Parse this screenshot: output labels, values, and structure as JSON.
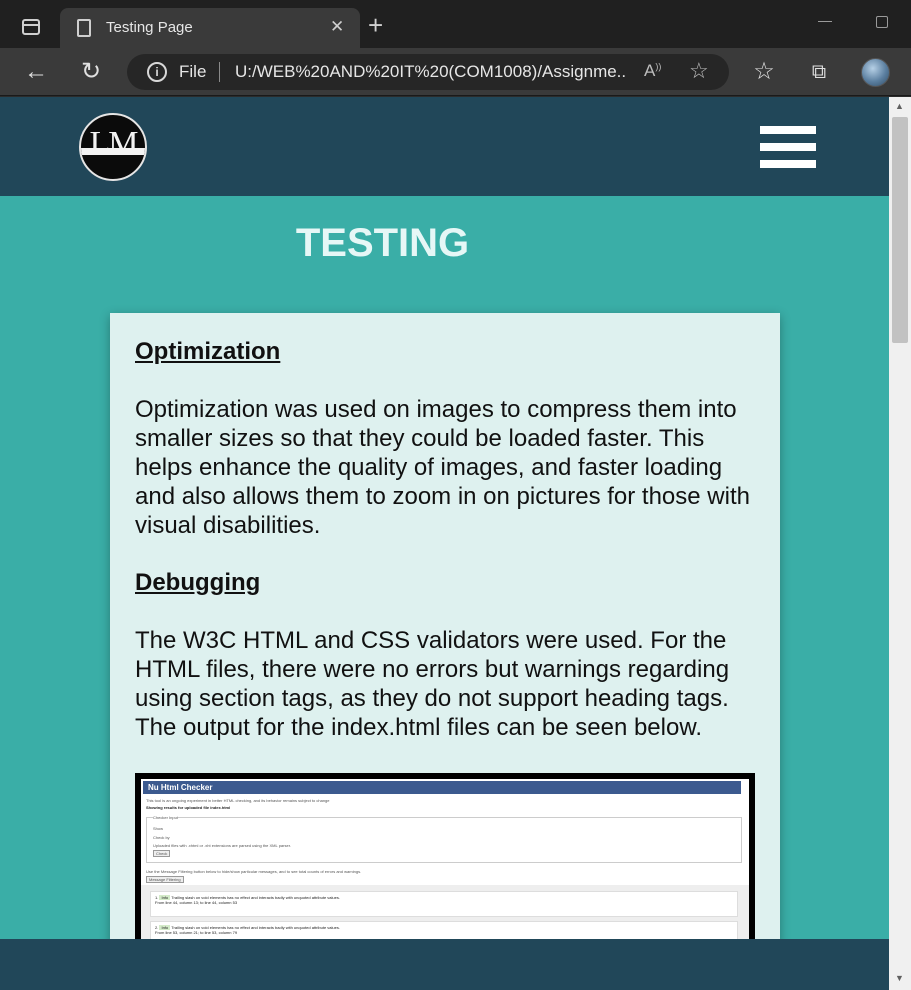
{
  "browser": {
    "tab_title": "Testing Page",
    "tab_close": "✕",
    "new_tab": "+",
    "file_label": "File",
    "url": "U:/WEB%20AND%20IT%20(COM1008)/Assignme...",
    "read_aloud": "A",
    "back": "←",
    "refresh": "↻",
    "favorites": "☆",
    "info": "i"
  },
  "site": {
    "logo_text": "LM",
    "page_title": "TESTING"
  },
  "content": {
    "optimization_heading": "Optimization",
    "optimization_text": "Optimization was used on images to compress them into smaller sizes so that they could be loaded faster. This helps enhance the quality of images, and faster loading and also allows them to zoom in on pictures for those with visual disabilities.",
    "debugging_heading": "Debugging",
    "debugging_text": "The W3C HTML and CSS validators were used. For the HTML files, there were no errors but warnings regarding using section tags, as they do not support heading tags. The output for the index.html files can be seen below."
  },
  "validator": {
    "title": "Nu Html Checker",
    "intro": "This tool is an ongoing experiment in better HTML checking, and its behavior remains subject to change",
    "results_for": "Showing results for uploaded file index.html",
    "checker_input": "Checker Input",
    "show_label": "Show",
    "check_by": "Check by",
    "upload_note": "Uploaded files with .xhtml or .xht extensions are parsed using the XML parser.",
    "check_button": "Check",
    "filter_note": "Use the Message Filtering button below to hide/show particular messages, and to see total counts of errors and warnings.",
    "filter_button": "Message Filtering",
    "messages": [
      {
        "num": "1.",
        "tag": "Info",
        "text": "Trailing slash on void elements has no effect and interacts badly with unquoted attribute values.",
        "loc": "From line 44, column 13; to line 44, column 53"
      },
      {
        "num": "2.",
        "tag": "Info",
        "text": "Trailing slash on void elements has no effect and interacts badly with unquoted attribute values.",
        "loc": "From line 53, column 21; to line 53, column 79"
      }
    ]
  },
  "colors": {
    "header": "#214759",
    "page_bg": "#3aaea7",
    "card_bg": "#def1ef"
  },
  "icons": [
    "window-icon",
    "document-icon",
    "close-icon",
    "plus-icon",
    "back-arrow-icon",
    "refresh-icon",
    "info-icon",
    "read-aloud-icon",
    "add-favorite-icon",
    "favorites-icon",
    "collections-icon",
    "profile-avatar",
    "hamburger-menu-icon"
  ]
}
